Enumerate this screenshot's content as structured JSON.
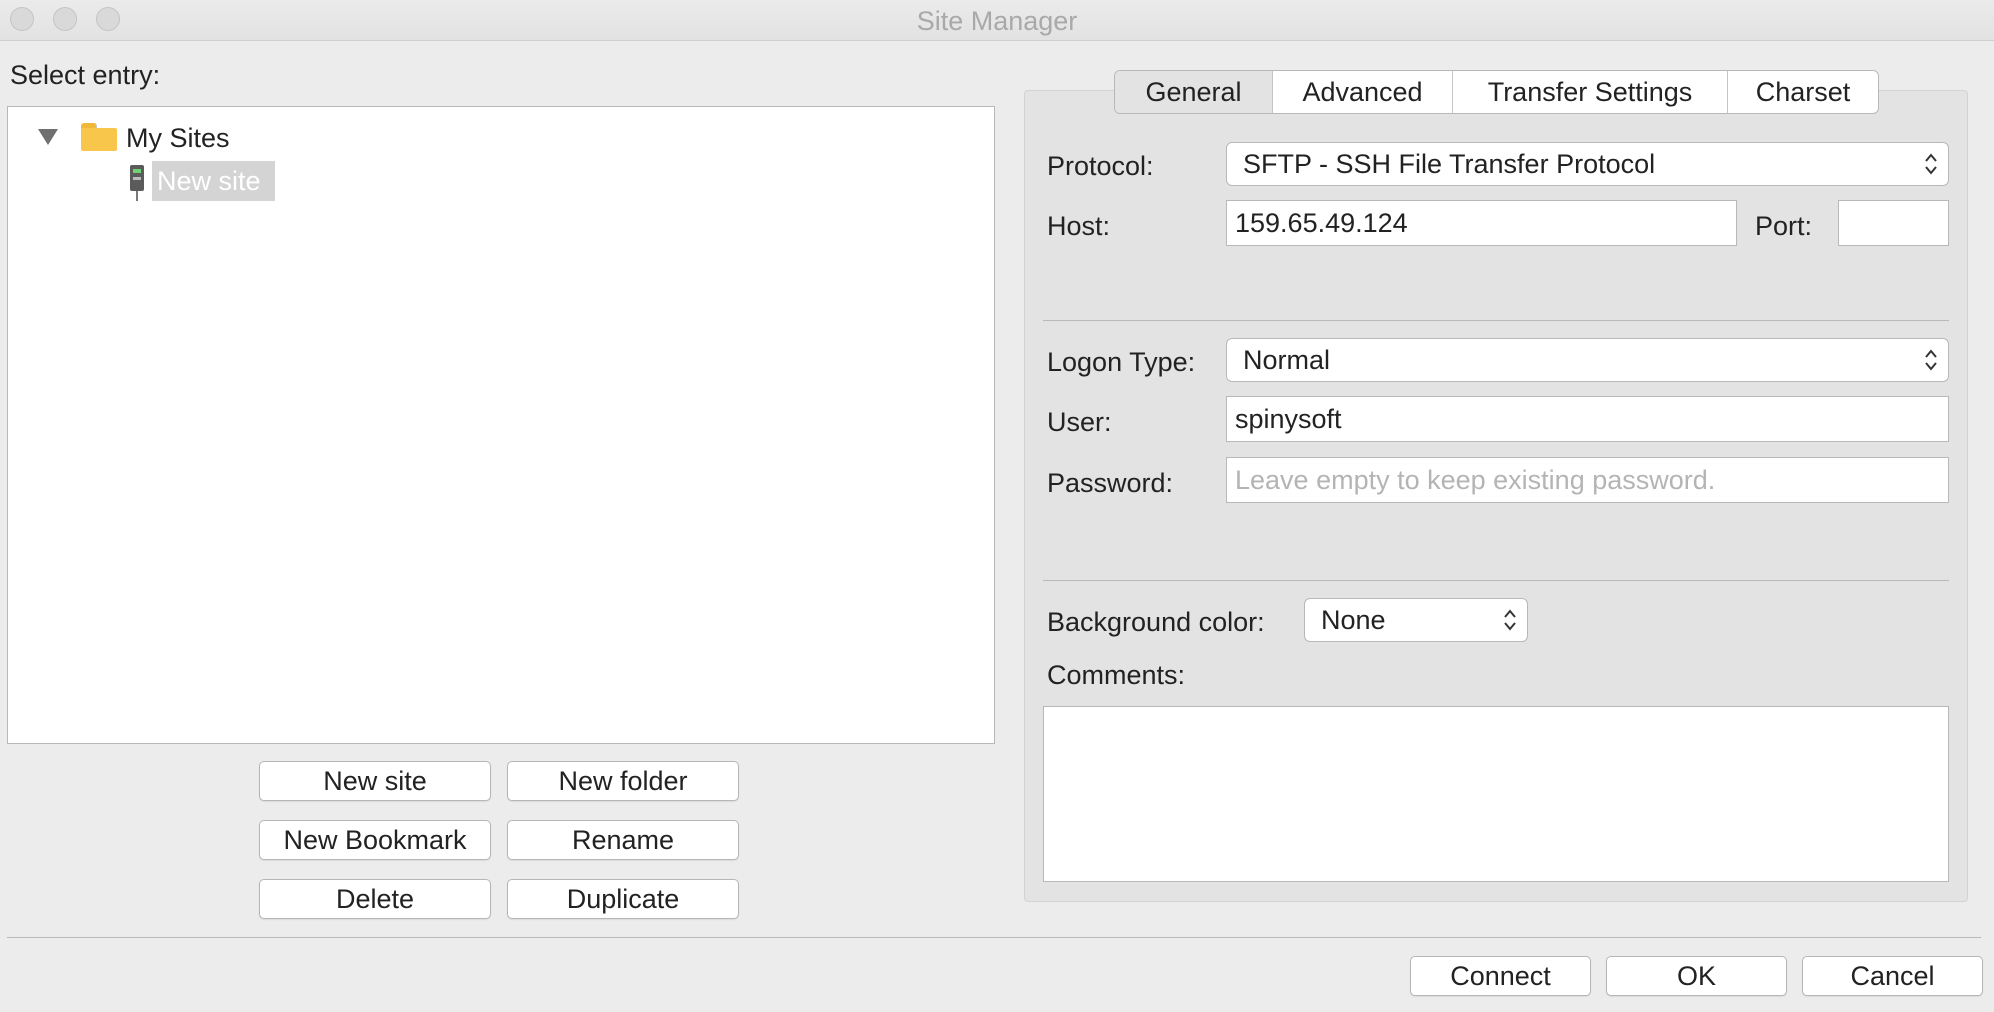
{
  "window": {
    "title": "Site Manager"
  },
  "left": {
    "select_entry_label": "Select entry:",
    "tree": {
      "root": {
        "label": "My Sites",
        "icon": "folder-icon",
        "expanded": true
      },
      "children": [
        {
          "label": "New site",
          "icon": "server-icon",
          "selected": true
        }
      ]
    },
    "buttons": {
      "new_site": "New site",
      "new_folder": "New folder",
      "new_bookmark": "New Bookmark",
      "rename": "Rename",
      "delete": "Delete",
      "duplicate": "Duplicate"
    }
  },
  "tabs": [
    {
      "label": "General",
      "active": true
    },
    {
      "label": "Advanced",
      "active": false
    },
    {
      "label": "Transfer Settings",
      "active": false
    },
    {
      "label": "Charset",
      "active": false
    }
  ],
  "general": {
    "protocol_label": "Protocol:",
    "protocol_value": "SFTP - SSH File Transfer Protocol",
    "host_label": "Host:",
    "host_value": "159.65.49.124",
    "port_label": "Port:",
    "port_value": "",
    "logon_type_label": "Logon Type:",
    "logon_type_value": "Normal",
    "user_label": "User:",
    "user_value": "spinysoft",
    "password_label": "Password:",
    "password_placeholder": "Leave empty to keep existing password.",
    "background_color_label": "Background color:",
    "background_color_value": "None",
    "comments_label": "Comments:",
    "comments_value": ""
  },
  "footer": {
    "connect": "Connect",
    "ok": "OK",
    "cancel": "Cancel"
  },
  "colors": {
    "window_bg": "#ececec",
    "panel_bg": "#e3e3e3",
    "selection_bg": "#d4d4d4",
    "folder": "#f8c64a"
  }
}
